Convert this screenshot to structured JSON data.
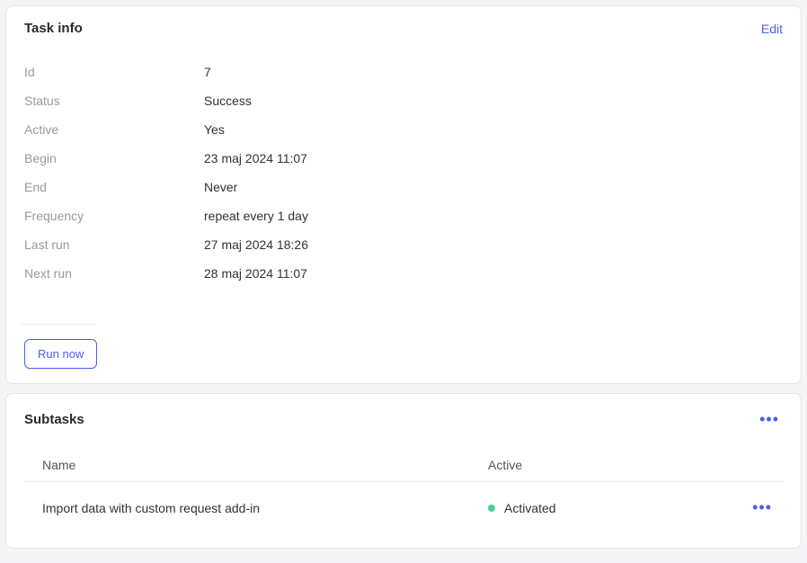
{
  "task_info": {
    "title": "Task info",
    "edit_label": "Edit",
    "fields": [
      {
        "label": "Id",
        "value": "7"
      },
      {
        "label": "Status",
        "value": "Success"
      },
      {
        "label": "Active",
        "value": "Yes"
      },
      {
        "label": "Begin",
        "value": "23 maj 2024 11:07"
      },
      {
        "label": "End",
        "value": "Never"
      },
      {
        "label": "Frequency",
        "value": "repeat every 1 day"
      },
      {
        "label": "Last run",
        "value": "27 maj 2024 18:26"
      },
      {
        "label": "Next run",
        "value": "28 maj 2024 11:07"
      }
    ],
    "run_now_label": "Run now"
  },
  "subtasks": {
    "title": "Subtasks",
    "columns": {
      "name": "Name",
      "active": "Active"
    },
    "rows": [
      {
        "name": "Import data with custom request add-in",
        "active_label": "Activated",
        "status_color": "#4ad295"
      }
    ]
  }
}
